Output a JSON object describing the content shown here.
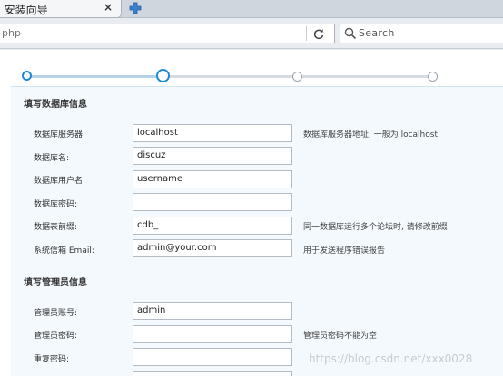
{
  "tab": {
    "title": "! 安装向导",
    "close": "×"
  },
  "address": {
    "url": "php",
    "search_placeholder": "Search"
  },
  "wizard": {
    "steps": [
      {
        "state": "done"
      },
      {
        "state": "current"
      },
      {
        "state": "todo"
      },
      {
        "state": "todo"
      }
    ]
  },
  "db_section": {
    "title": "填写数据库信息",
    "fields": [
      {
        "label": "数据库服务器:",
        "value": "localhost",
        "hint": "数据库服务器地址, 一般为 localhost"
      },
      {
        "label": "数据库名:",
        "value": "discuz",
        "hint": ""
      },
      {
        "label": "数据库用户名:",
        "value": "username",
        "hint": ""
      },
      {
        "label": "数据库密码:",
        "value": "",
        "hint": ""
      },
      {
        "label": "数据表前缀:",
        "value": "cdb_",
        "hint": "同一数据库运行多个论坛时, 请修改前缀"
      },
      {
        "label": "系统信箱 Email:",
        "value": "admin@your.com",
        "hint": "用于发送程序错误报告"
      }
    ]
  },
  "admin_section": {
    "title": "填写管理员信息",
    "fields": [
      {
        "label": "管理员账号:",
        "value": "admin",
        "hint": ""
      },
      {
        "label": "管理员密码:",
        "value": "",
        "hint": "管理员密码不能为空"
      },
      {
        "label": "重复密码:",
        "value": "",
        "hint": ""
      }
    ]
  },
  "watermark": "https://blog.csdn.net/xxx0028"
}
